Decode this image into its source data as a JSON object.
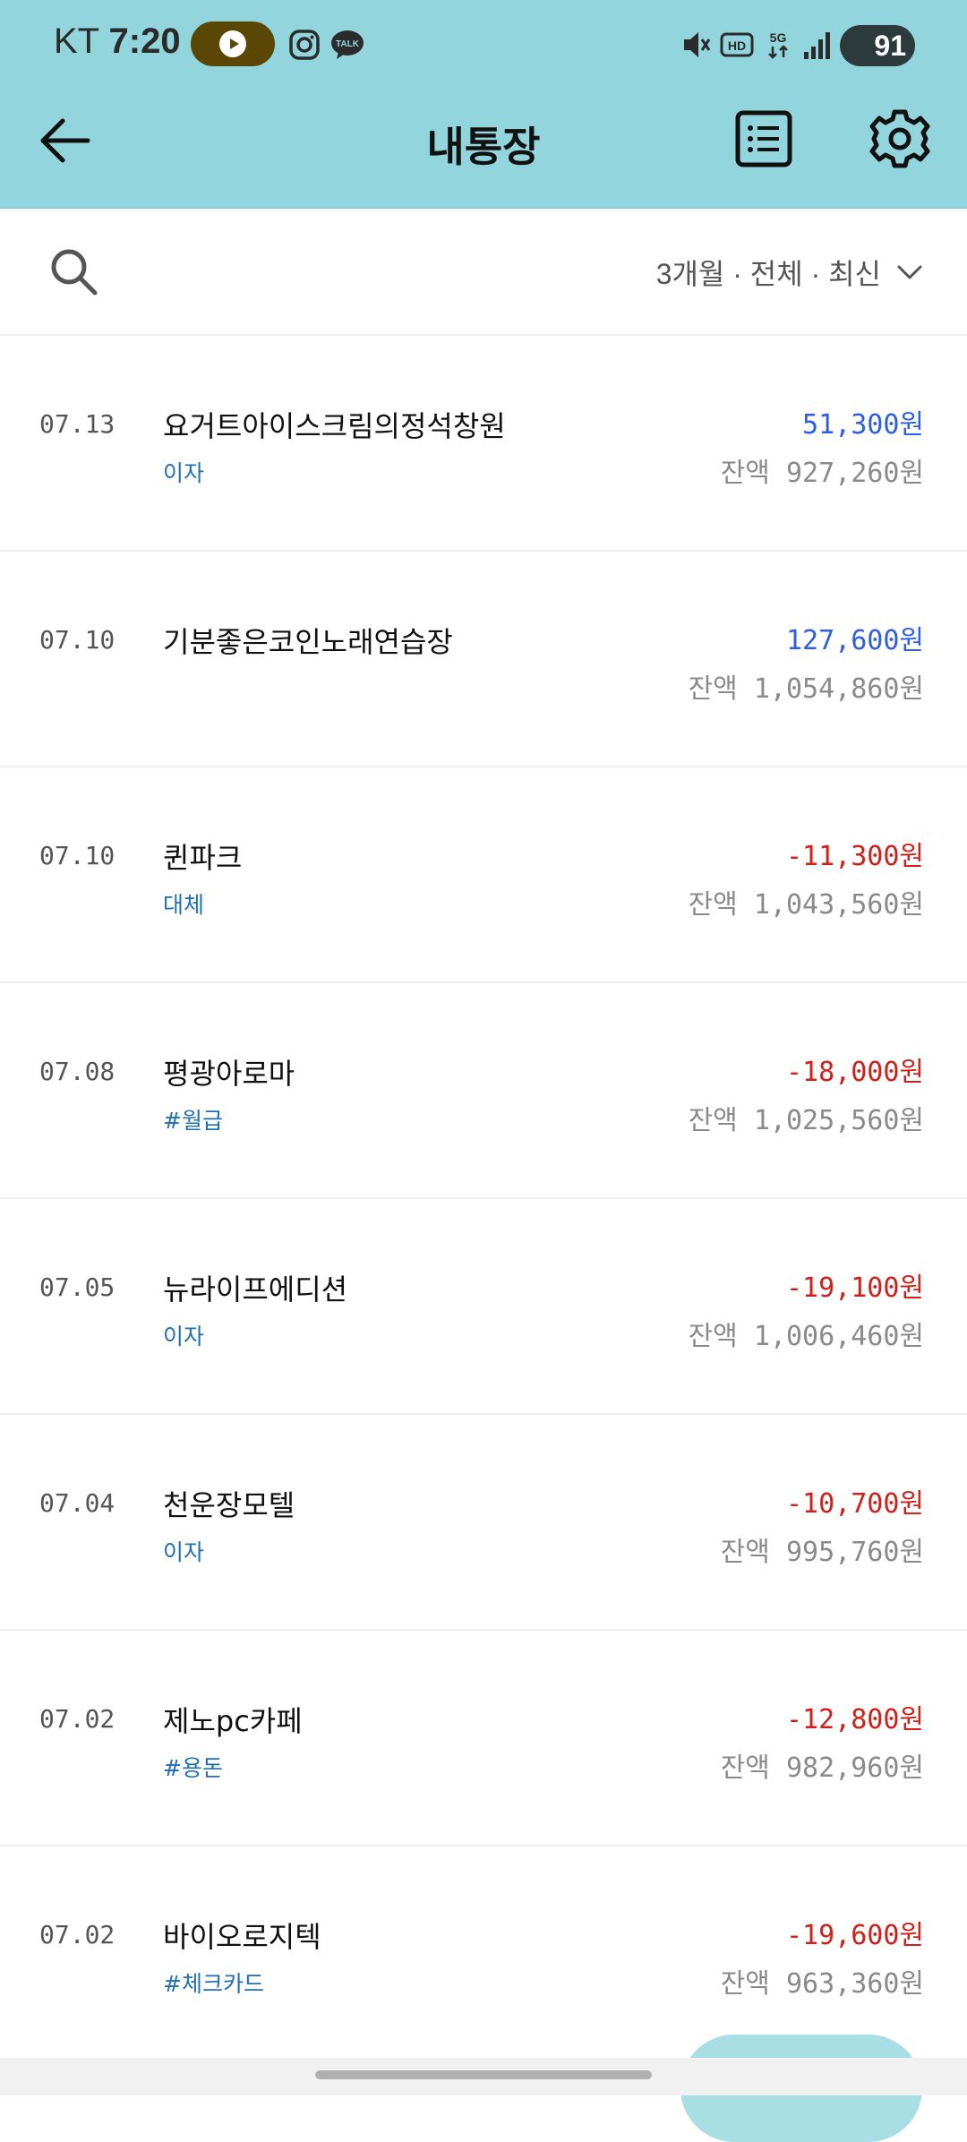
{
  "status_bar": {
    "carrier": "KT",
    "time": "7:20",
    "battery": "91",
    "icons": [
      "youtube-music-icon",
      "instagram-icon",
      "kakaotalk-icon",
      "mute-vibrate-icon",
      "hd-icon",
      "5g-icon",
      "signal-icon",
      "battery-icon"
    ],
    "talk_label": "TALK"
  },
  "header": {
    "title": "내통장"
  },
  "filter": {
    "label": "3개월 · 전체 · 최신"
  },
  "colors": {
    "header_bg": "#93d5dd",
    "deposit": "#2f5fe0",
    "withdrawal": "#d0201a",
    "tag": "#1f6fb5"
  },
  "transactions": [
    {
      "date": "07.13",
      "name": "요거트아이스크림의정석창원",
      "tag": "이자",
      "amount": "51,300원",
      "type": "deposit",
      "balance": "잔액 927,260원"
    },
    {
      "date": "07.10",
      "name": "기분좋은코인노래연습장",
      "tag": "",
      "amount": "127,600원",
      "type": "deposit",
      "balance": "잔액 1,054,860원"
    },
    {
      "date": "07.10",
      "name": "퀸파크",
      "tag": "대체",
      "amount": "-11,300원",
      "type": "withdrawal",
      "balance": "잔액 1,043,560원"
    },
    {
      "date": "07.08",
      "name": "평광아로마",
      "tag": "#월급",
      "amount": "-18,000원",
      "type": "withdrawal",
      "balance": "잔액 1,025,560원"
    },
    {
      "date": "07.05",
      "name": "뉴라이프에디션",
      "tag": "이자",
      "amount": "-19,100원",
      "type": "withdrawal",
      "balance": "잔액 1,006,460원"
    },
    {
      "date": "07.04",
      "name": "천운장모텔",
      "tag": "이자",
      "amount": "-10,700원",
      "type": "withdrawal",
      "balance": "잔액 995,760원"
    },
    {
      "date": "07.02",
      "name": "제노pc카페",
      "tag": "#용돈",
      "amount": "-12,800원",
      "type": "withdrawal",
      "balance": "잔액 982,960원"
    },
    {
      "date": "07.02",
      "name": "바이오로지텍",
      "tag": "#체크카드",
      "amount": "-19,600원",
      "type": "withdrawal",
      "balance": "잔액 963,360원"
    }
  ]
}
